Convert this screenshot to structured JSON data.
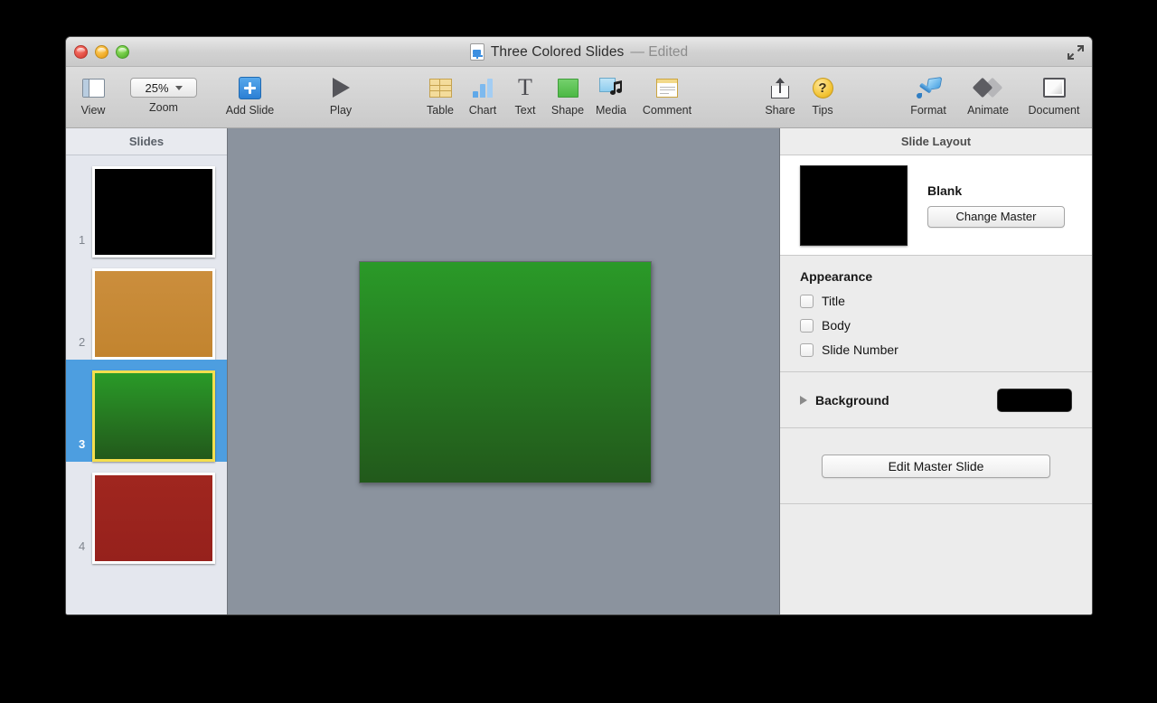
{
  "window": {
    "title": "Three Colored Slides",
    "title_status": "— Edited",
    "doc_icon": "keynote-document-icon",
    "fullscreen_icon": "fullscreen-expand-icon",
    "traffic_lights": [
      "close",
      "minimize",
      "maximize"
    ]
  },
  "toolbar": {
    "items": [
      {
        "label": "View",
        "icon": "view-sidebar-icon"
      },
      {
        "label": "Zoom",
        "icon": "zoom-dropdown-icon",
        "value": "25%"
      },
      {
        "label": "Add Slide",
        "icon": "add-slide-plus-icon"
      },
      {
        "label": "Play",
        "icon": "play-triangle-icon"
      },
      {
        "label": "Table",
        "icon": "table-grid-icon"
      },
      {
        "label": "Chart",
        "icon": "chart-bars-icon"
      },
      {
        "label": "Text",
        "icon": "text-t-icon"
      },
      {
        "label": "Shape",
        "icon": "shape-square-icon"
      },
      {
        "label": "Media",
        "icon": "media-photo-note-icon"
      },
      {
        "label": "Comment",
        "icon": "comment-note-icon"
      },
      {
        "label": "Share",
        "icon": "share-arrow-icon"
      },
      {
        "label": "Tips",
        "icon": "tips-question-icon"
      },
      {
        "label": "Format",
        "icon": "format-brush-icon"
      },
      {
        "label": "Animate",
        "icon": "animate-diamonds-icon"
      },
      {
        "label": "Document",
        "icon": "document-window-icon"
      }
    ]
  },
  "navigator": {
    "header": "Slides",
    "slides": [
      {
        "number": "1",
        "color": "#000000",
        "gradient": "linear-gradient(to bottom, #000000, #000000)",
        "selected": false
      },
      {
        "number": "2",
        "color": "#c98b3c",
        "gradient": "linear-gradient(to bottom, #cb8e3d, #c2842f)",
        "selected": false
      },
      {
        "number": "3",
        "color": "#2a9a28",
        "gradient": "linear-gradient(to bottom, #2a9a28, #22591b)",
        "selected": true
      },
      {
        "number": "4",
        "color": "#9e2420",
        "gradient": "linear-gradient(to bottom, #a0261f, #96211c)",
        "selected": false
      }
    ]
  },
  "canvas": {
    "slide_gradient": "linear-gradient(to bottom, #2a9a28 0%, #22591b 100%)",
    "background_color": "#8b939e"
  },
  "inspector": {
    "header": "Slide Layout",
    "layout": {
      "master_thumb_color": "#000000",
      "name": "Blank",
      "change_master_label": "Change Master"
    },
    "appearance": {
      "title": "Appearance",
      "options": [
        {
          "label": "Title",
          "checked": false
        },
        {
          "label": "Body",
          "checked": false
        },
        {
          "label": "Slide Number",
          "checked": false
        }
      ]
    },
    "background": {
      "label": "Background",
      "expanded": false,
      "swatch_color": "#000000"
    },
    "edit_master_label": "Edit Master Slide"
  }
}
